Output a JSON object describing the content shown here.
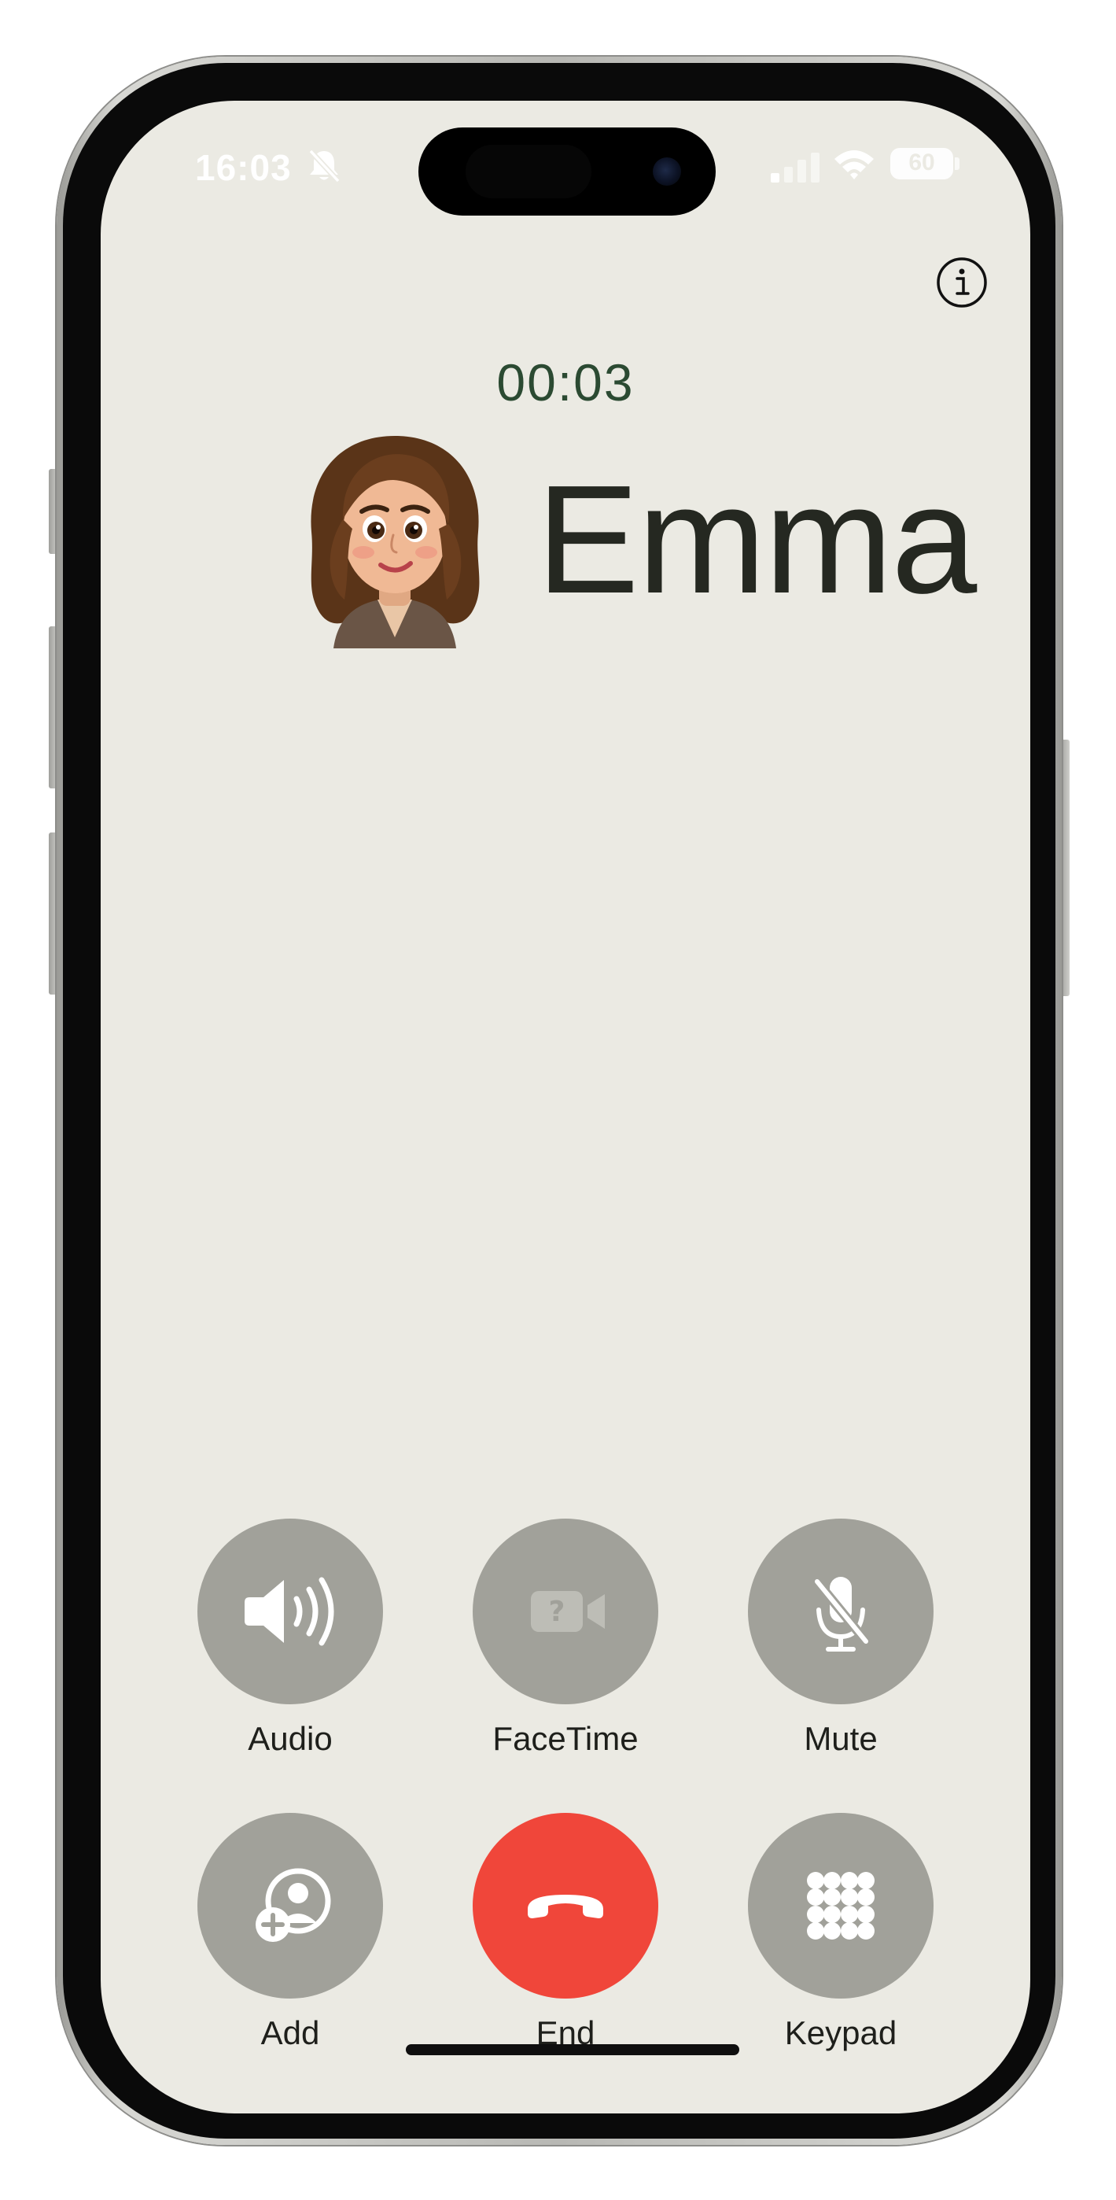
{
  "status_bar": {
    "time": "16:03",
    "silent_icon": "bell-slash-icon",
    "signal_icon": "cellular-signal-icon",
    "wifi_icon": "wifi-icon",
    "battery_level": "60"
  },
  "call": {
    "info_icon": "info-circle-icon",
    "duration": "00:03",
    "contact_name": "Emma",
    "avatar": "contact-avatar"
  },
  "controls": {
    "audio": {
      "label": "Audio",
      "icon": "speaker-wave-icon"
    },
    "facetime": {
      "label": "FaceTime",
      "icon": "video-question-icon"
    },
    "mute": {
      "label": "Mute",
      "icon": "microphone-slash-icon"
    },
    "add": {
      "label": "Add",
      "icon": "person-add-icon"
    },
    "end": {
      "label": "End",
      "icon": "phone-down-icon"
    },
    "keypad": {
      "label": "Keypad",
      "icon": "keypad-grid-icon"
    }
  },
  "colors": {
    "screen_background": "#ebeae3",
    "control_button": "#a1a19a",
    "end_button": "#f0463a",
    "timer_text": "#2b4a32"
  }
}
